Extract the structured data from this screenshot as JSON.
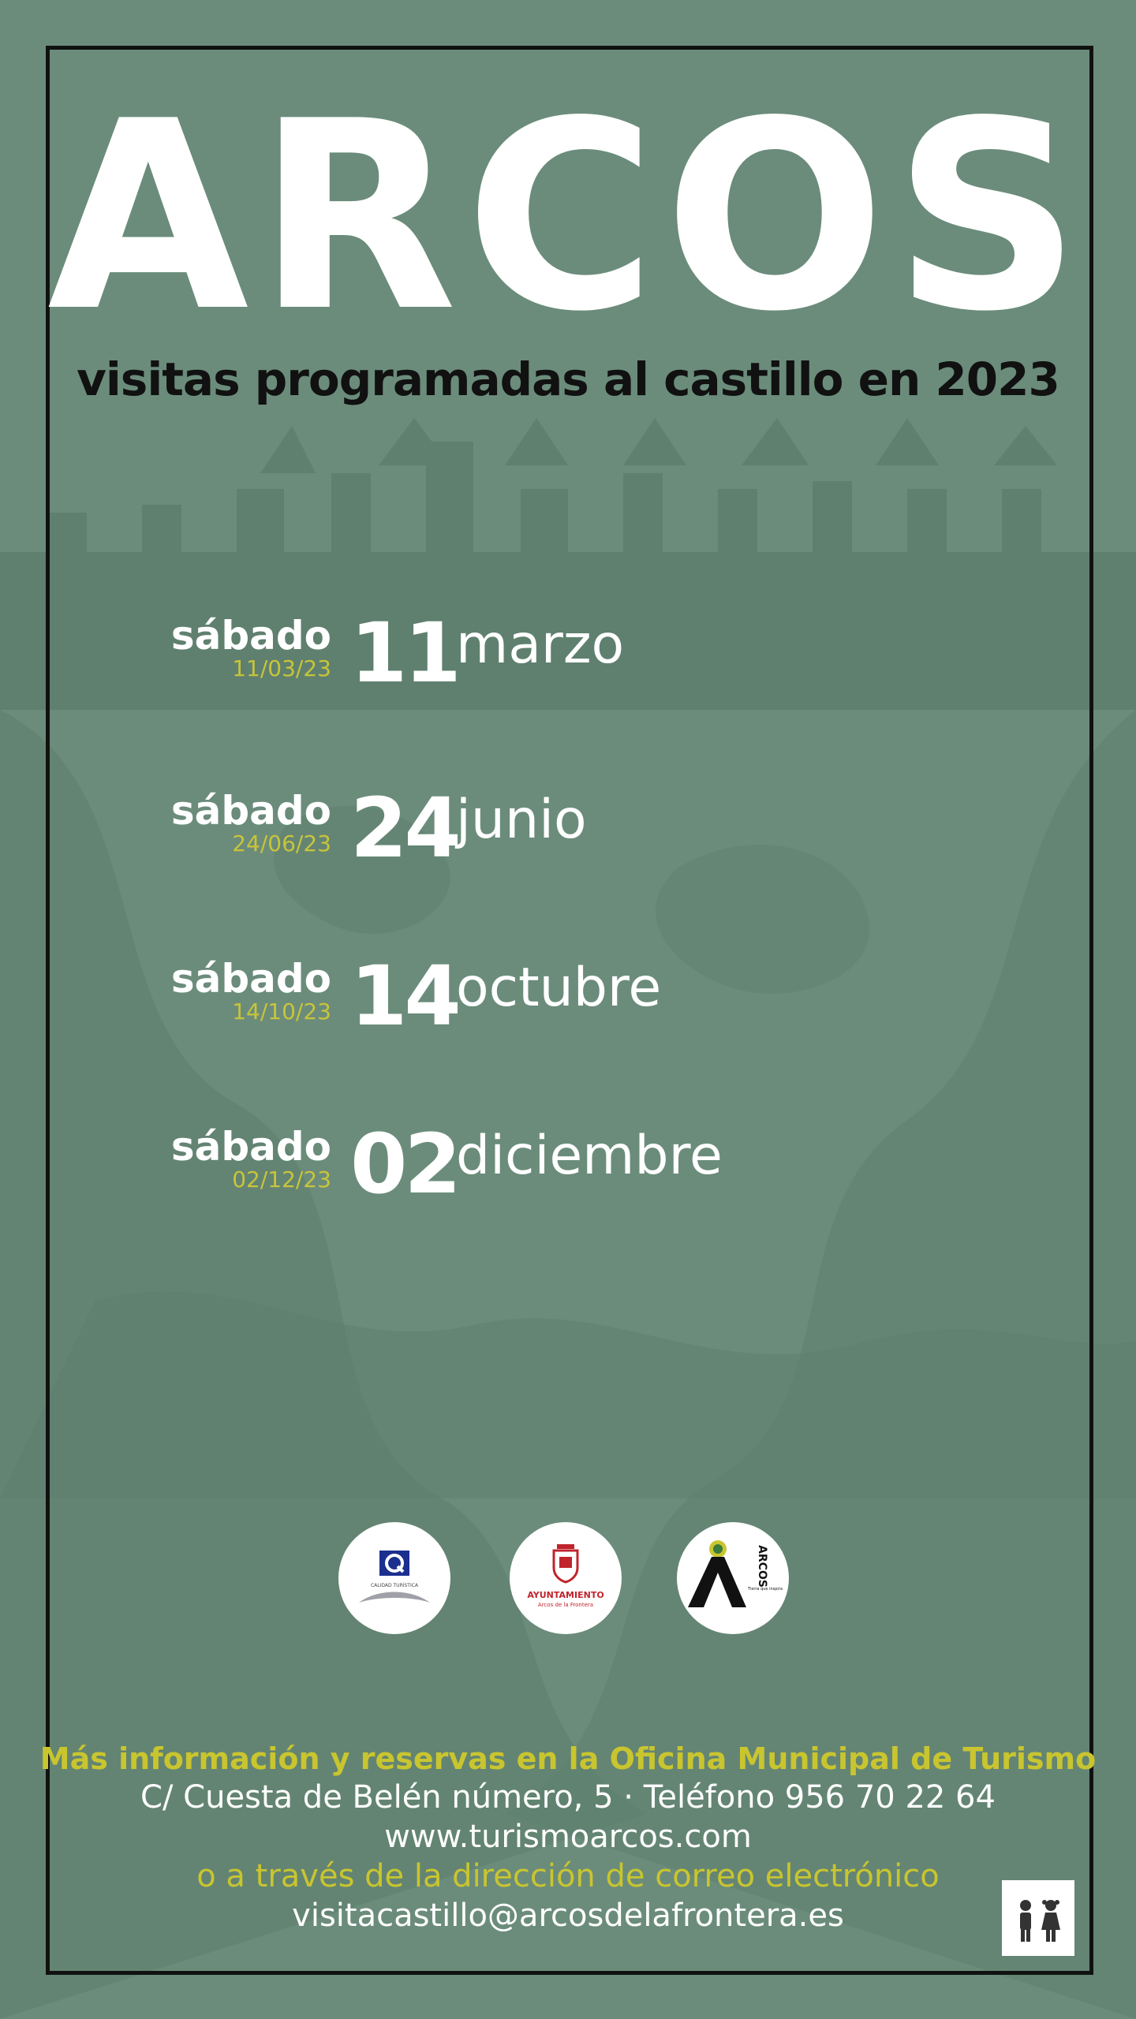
{
  "poster": {
    "title": "ARCOS",
    "subtitle": "visitas programadas al castillo en 2023"
  },
  "visits": [
    {
      "weekday": "sábado",
      "short_date": "11/03/23",
      "day": "11",
      "month": "marzo"
    },
    {
      "weekday": "sábado",
      "short_date": "24/06/23",
      "day": "24",
      "month": "junio"
    },
    {
      "weekday": "sábado",
      "short_date": "14/10/23",
      "day": "14",
      "month": "octubre"
    },
    {
      "weekday": "sábado",
      "short_date": "02/12/23",
      "day": "02",
      "month": "diciembre"
    }
  ],
  "logos": {
    "calidad": {
      "icon": "quality-q-icon",
      "text": "CALIDAD TURÍSTICA"
    },
    "ayuntamiento": {
      "icon": "coat-of-arms-icon",
      "line1": "AYUNTAMIENTO",
      "line2": "Arcos de la Frontera"
    },
    "arcos_brand": {
      "icon": "arcos-a-icon",
      "word": "ARCOS",
      "tagline": "Tierra que inspira"
    }
  },
  "info": {
    "heading": "Más información y reservas en la Oficina Municipal de Turismo",
    "address": "C/ Cuesta de Belén número, 5 · Teléfono 956 70 22 64",
    "website": "www.turismoarcos.com",
    "email_intro": "o a través de la dirección de correo electrónico",
    "email": "visitacastillo@arcosdelafrontera.es"
  },
  "kids_badge": {
    "icon": "children-icon"
  },
  "colors": {
    "background": "#6b8c7b",
    "shape_dark": "#587767",
    "accent_yellow": "#c9c52f",
    "text_white": "#ffffff",
    "frame": "#111111"
  }
}
